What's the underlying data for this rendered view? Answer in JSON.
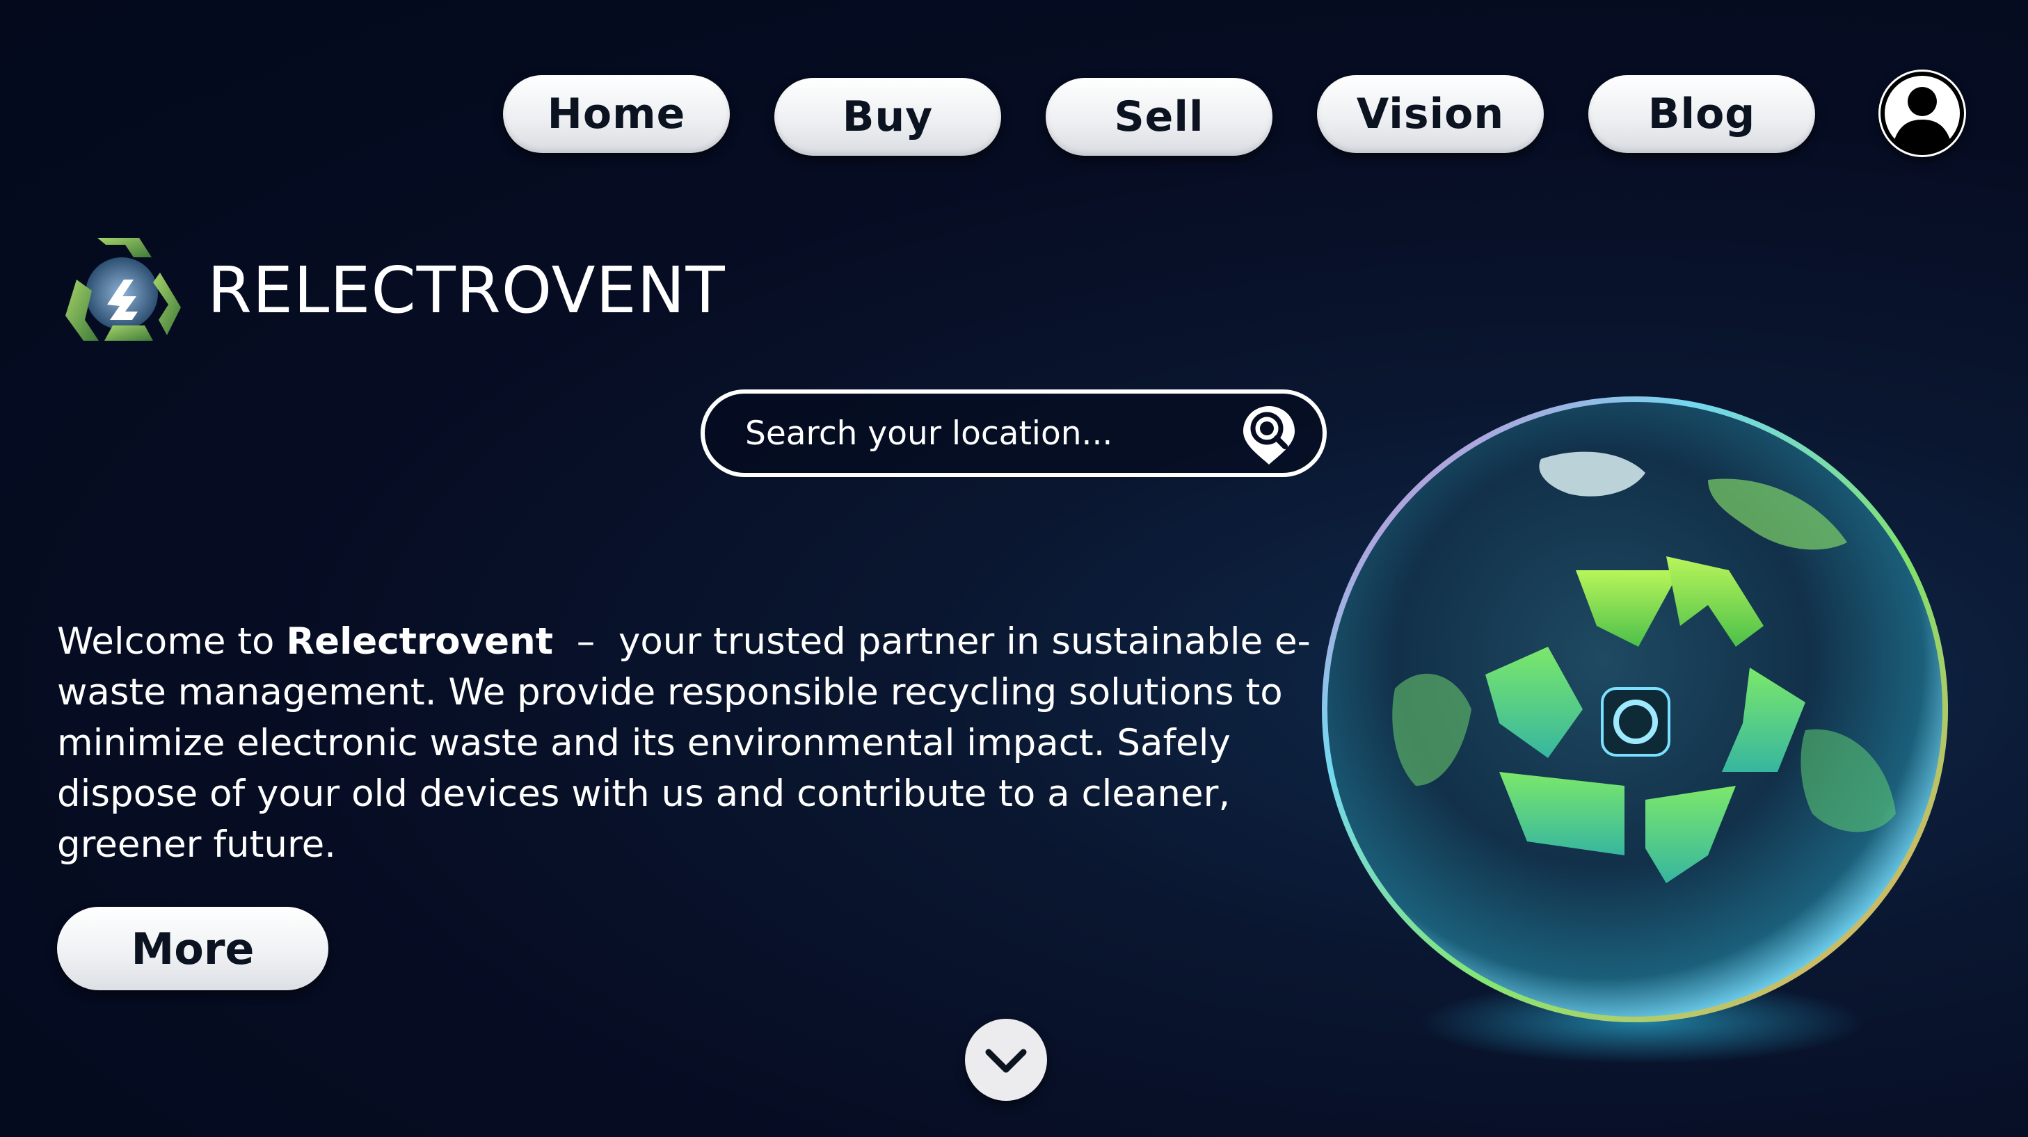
{
  "nav": {
    "items": [
      {
        "label": "Home"
      },
      {
        "label": "Buy"
      },
      {
        "label": "Sell"
      },
      {
        "label": "Vision"
      },
      {
        "label": "Blog"
      }
    ],
    "profile_icon": "user-circle-icon"
  },
  "brand": {
    "name": "RELECTROVENT",
    "logo_icon": "recycle-logo-icon"
  },
  "search": {
    "placeholder": "Search your location...",
    "icon": "location-search-icon"
  },
  "welcome": {
    "prefix": "Welcome to ",
    "brand": "Relectrovent",
    "separator": "  –  ",
    "body": "your trusted partner in sustainable e-waste management. We provide responsible recycling solutions to minimize electronic waste and its environmental impact. Safely dispose of your old devices with us and contribute to a cleaner, greener future."
  },
  "more_button": {
    "label": "More"
  },
  "scroll_down": {
    "icon": "chevron-down-icon"
  },
  "hero_image": {
    "icon": "recycle-globe-icon"
  },
  "colors": {
    "background": "#060c22",
    "pill": "#eceef1",
    "pill_text": "#0b1320",
    "recycle_green": "#7ed957"
  }
}
